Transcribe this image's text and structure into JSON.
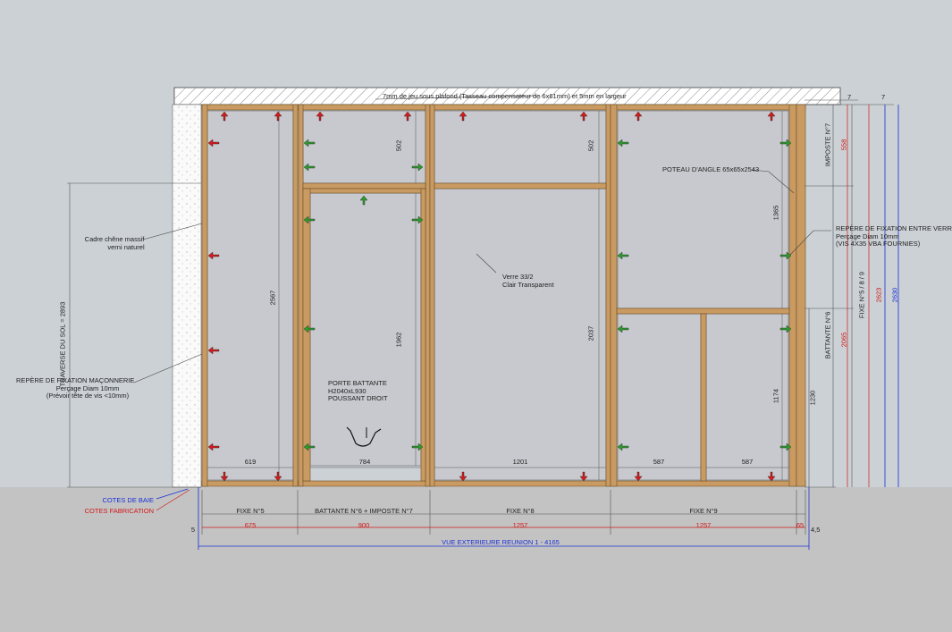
{
  "notes": {
    "top": "7mm de jeu sous plafond (Tasseau compensateur de 6x61mm) et 5mm en largeur",
    "frame_line1": "Cadre chêne massif",
    "frame_line2": "verni naturel",
    "masonry_line1": "REPÈRE DE FIXATION MAÇONNERIE",
    "masonry_line2": "Perçage Diam 10mm",
    "masonry_line3": "(Prévoir tête de vis <10mm)",
    "traverse": "TRAVERSE DU SOL = 2893",
    "glass_line1": "Verre 33/2",
    "glass_line2": "Clair Transparent",
    "door_line1": "PORTE BATTANTE",
    "door_line2": "H2040xL930",
    "door_line3": "POUSSANT DROIT",
    "post": "POTEAU D'ANGLE 65x65x2543",
    "glass_fix_line1": "REPÈRE DE FIXATION ENTRE VERRIÈ",
    "glass_fix_line2": "Perçage Diam 10mm",
    "glass_fix_line3": "(VIS 4X35 VBA FOURNIES)"
  },
  "dims": {
    "d619": "619",
    "d784": "784",
    "d1201": "1201",
    "d587a": "587",
    "d587b": "587",
    "d502a": "502",
    "d502b": "502",
    "d2567": "2567",
    "d1962": "1962",
    "d2037": "2037",
    "d1365": "1365",
    "d1174": "1174",
    "imposte": "IMPOSTE N°7",
    "battante": "BATTANTE N°6",
    "fixe589": "FIXE N°5 / 8 / 9",
    "d558": "558",
    "d2065": "2065",
    "d2623": "2623",
    "d2630": "2630",
    "d1230": "1230",
    "m7a": "7",
    "m7b": "7"
  },
  "legend": {
    "baie": "COTES DE BAIE",
    "fabrication": "COTES FABRICATION"
  },
  "bottom": {
    "fixe5": "FIXE N°5",
    "battante": "BATTANTE N°6 + IMPOSTE N°7",
    "fixe8": "FIXE N°8",
    "fixe9": "FIXE N°9",
    "w675": "675",
    "w900": "900",
    "w1257a": "1257",
    "w1257b": "1257",
    "w65": "65",
    "m5": "5",
    "m45": "4,5",
    "total": "VUE EXTERIEURE REUNION 1 - 4165"
  },
  "colors": {
    "frame": "#c99b62",
    "frame_edge": "#6e4f26",
    "glass": "#c6c8cd",
    "arrow_red": "#d41c1c",
    "arrow_green": "#2e9a2e",
    "dim_blue": "#1a2fd6"
  }
}
